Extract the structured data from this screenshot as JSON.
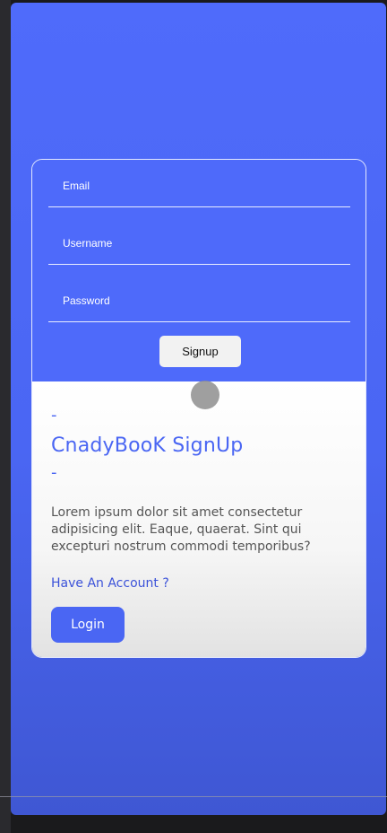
{
  "form": {
    "email_label": "Email",
    "username_label": "Username",
    "password_label": "Password",
    "signup_label": "Signup"
  },
  "info": {
    "dash_top": "-",
    "title": "CnadyBooK SignUp",
    "dash_bottom": "-",
    "description": "Lorem ipsum dolor sit amet consectetur adipisicing elit. Eaque, quaerat. Sint qui excepturi nostrum commodi temporibus?",
    "have_account": "Have An Account ?",
    "login_label": "Login"
  },
  "colors": {
    "accent": "#4a66f3",
    "background_top": "#4f6bfb",
    "background_bottom": "#3f57d3",
    "card_white": "#ffffff"
  }
}
